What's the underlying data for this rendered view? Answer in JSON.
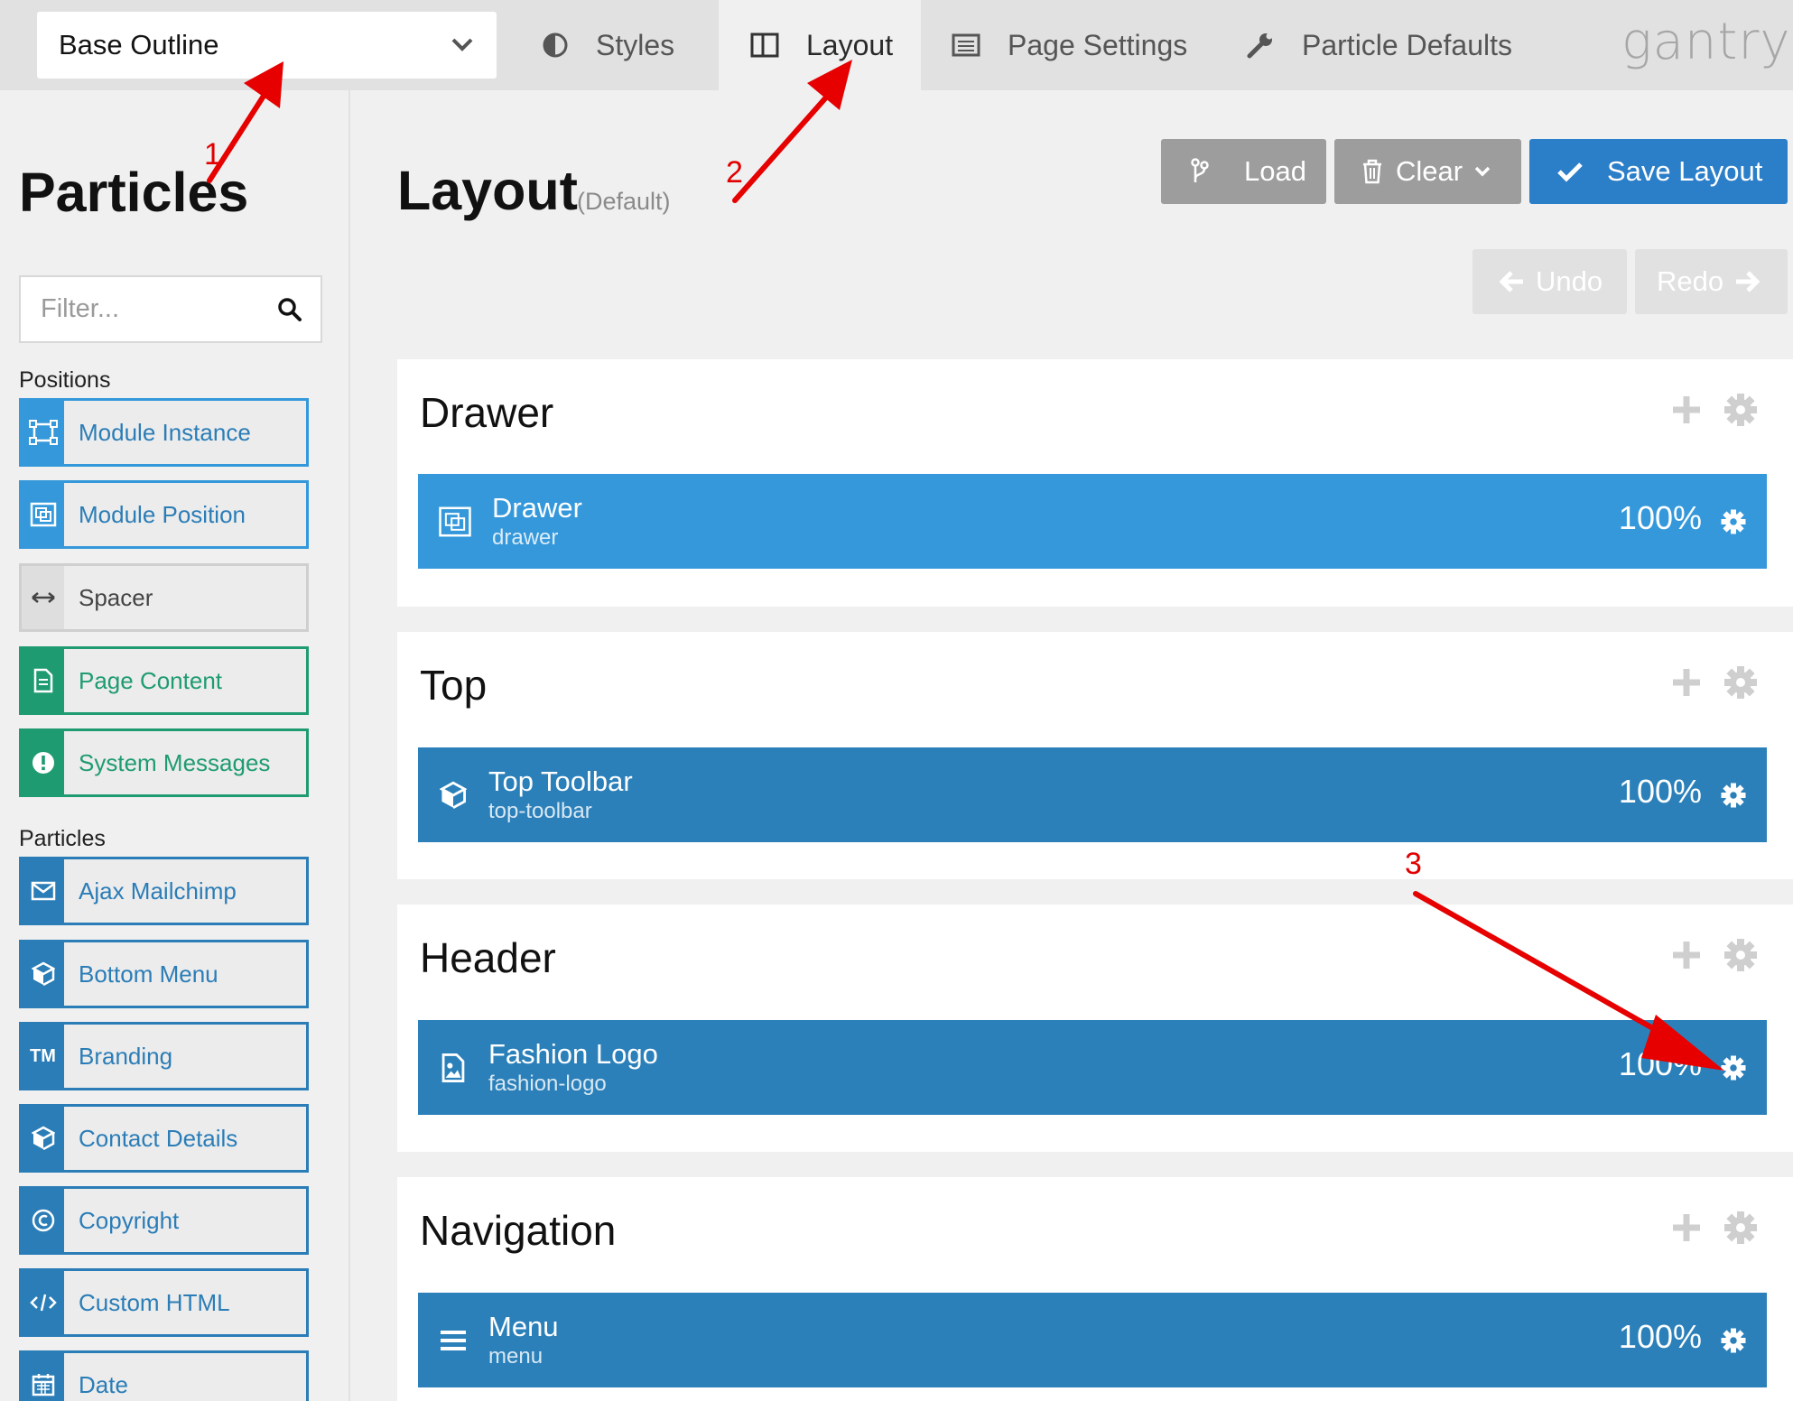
{
  "topbar": {
    "outline_select": "Base Outline",
    "tabs": [
      {
        "label": "Styles",
        "icon": "contrast-icon"
      },
      {
        "label": "Layout",
        "icon": "columns-icon",
        "active": true
      },
      {
        "label": "Page Settings",
        "icon": "list-icon"
      },
      {
        "label": "Particle Defaults",
        "icon": "wrench-icon"
      }
    ],
    "logo": "gantry"
  },
  "sidebar": {
    "title": "Particles",
    "filter_placeholder": "Filter...",
    "positions_label": "Positions",
    "positions": [
      {
        "label": "Module Instance",
        "style": "lightblue",
        "icon": "module-instance-icon"
      },
      {
        "label": "Module Position",
        "style": "lightblue",
        "icon": "module-position-icon"
      },
      {
        "label": "Spacer",
        "style": "gray",
        "icon": "spacer-icon"
      },
      {
        "label": "Page Content",
        "style": "green",
        "icon": "page-content-icon"
      },
      {
        "label": "System Messages",
        "style": "green",
        "icon": "exclamation-icon"
      }
    ],
    "particles_label": "Particles",
    "particles": [
      {
        "label": "Ajax Mailchimp",
        "icon": "envelope-icon"
      },
      {
        "label": "Bottom Menu",
        "icon": "cube-icon"
      },
      {
        "label": "Branding",
        "icon": "tm-icon",
        "glyph": "TM"
      },
      {
        "label": "Contact Details",
        "icon": "cube-icon"
      },
      {
        "label": "Copyright",
        "icon": "copyright-icon"
      },
      {
        "label": "Custom HTML",
        "icon": "code-icon"
      },
      {
        "label": "Date",
        "icon": "calendar-icon"
      }
    ]
  },
  "main": {
    "title": "Layout",
    "subtitle": "(Default)",
    "buttons": {
      "load": "Load",
      "clear": "Clear",
      "save": "Save Layout",
      "undo": "Undo",
      "redo": "Redo"
    },
    "sections": [
      {
        "title": "Drawer",
        "block": {
          "name": "Drawer",
          "key": "drawer",
          "width": "100%",
          "color": "#3498db",
          "icon": "module-position-icon"
        }
      },
      {
        "title": "Top",
        "block": {
          "name": "Top Toolbar",
          "key": "top-toolbar",
          "width": "100%",
          "color": "#2b80ba",
          "icon": "cube-icon"
        }
      },
      {
        "title": "Header",
        "block": {
          "name": "Fashion Logo",
          "key": "fashion-logo",
          "width": "100%",
          "color": "#2b80ba",
          "icon": "image-icon"
        }
      },
      {
        "title": "Navigation",
        "block": {
          "name": "Menu",
          "key": "menu",
          "width": "100%",
          "color": "#2b80ba",
          "icon": "hamburger-icon"
        }
      }
    ]
  },
  "annotations": [
    "1",
    "2",
    "3"
  ],
  "colors": {
    "accent": "#2b80ba",
    "annotation": "#e10000",
    "green": "#1f9b72"
  }
}
